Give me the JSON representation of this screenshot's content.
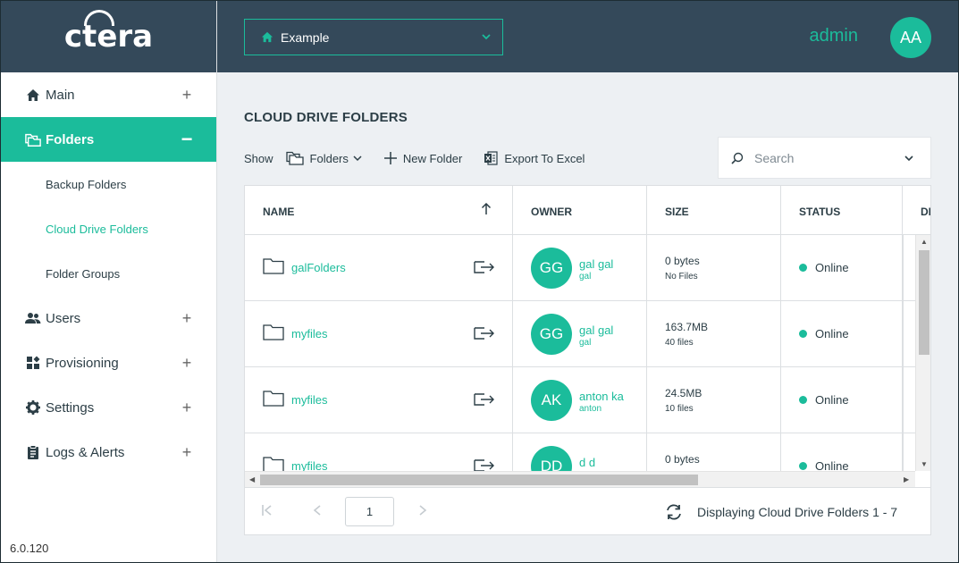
{
  "sidebar": {
    "logo": "ctera",
    "version": "6.0.120",
    "items": [
      {
        "label": "Main",
        "toggle": "+"
      },
      {
        "label": "Folders",
        "toggle": "−"
      },
      {
        "label": "Users",
        "toggle": "+"
      },
      {
        "label": "Provisioning",
        "toggle": "+"
      },
      {
        "label": "Settings",
        "toggle": "+"
      },
      {
        "label": "Logs & Alerts",
        "toggle": "+"
      }
    ],
    "subitems": [
      "Backup Folders",
      "Cloud Drive Folders",
      "Folder Groups"
    ]
  },
  "topbar": {
    "portal": "Example",
    "user_name": "admin",
    "user_initials": "AA"
  },
  "main": {
    "title": "CLOUD DRIVE FOLDERS",
    "show_label": "Show",
    "show_value": "Folders",
    "new_folder": "New Folder",
    "export": "Export To Excel",
    "search_placeholder": "Search"
  },
  "table": {
    "headers": {
      "name": "NAME",
      "owner": "OWNER",
      "size": "SIZE",
      "status": "STATUS",
      "extra": "DI"
    },
    "rows": [
      {
        "name": "galFolders",
        "owner_initials": "GG",
        "owner_name": "gal gal",
        "owner_user": "gal",
        "size": "0 bytes",
        "files": "No Files",
        "status": "Online"
      },
      {
        "name": "myfiles",
        "owner_initials": "GG",
        "owner_name": "gal gal",
        "owner_user": "gal",
        "size": "163.7MB",
        "files": "40 files",
        "status": "Online"
      },
      {
        "name": "myfiles",
        "owner_initials": "AK",
        "owner_name": "anton ka",
        "owner_user": "anton",
        "size": "24.5MB",
        "files": "10 files",
        "status": "Online"
      },
      {
        "name": "myfiles",
        "owner_initials": "DD",
        "owner_name": "d d",
        "owner_user": "",
        "size": "0 bytes",
        "files": "",
        "status": "Online"
      }
    ]
  },
  "pager": {
    "page": "1",
    "display": "Displaying Cloud Drive Folders 1 - 7"
  },
  "colors": {
    "accent": "#1bbc9b",
    "header": "#34495a",
    "background": "#edf0f3"
  }
}
